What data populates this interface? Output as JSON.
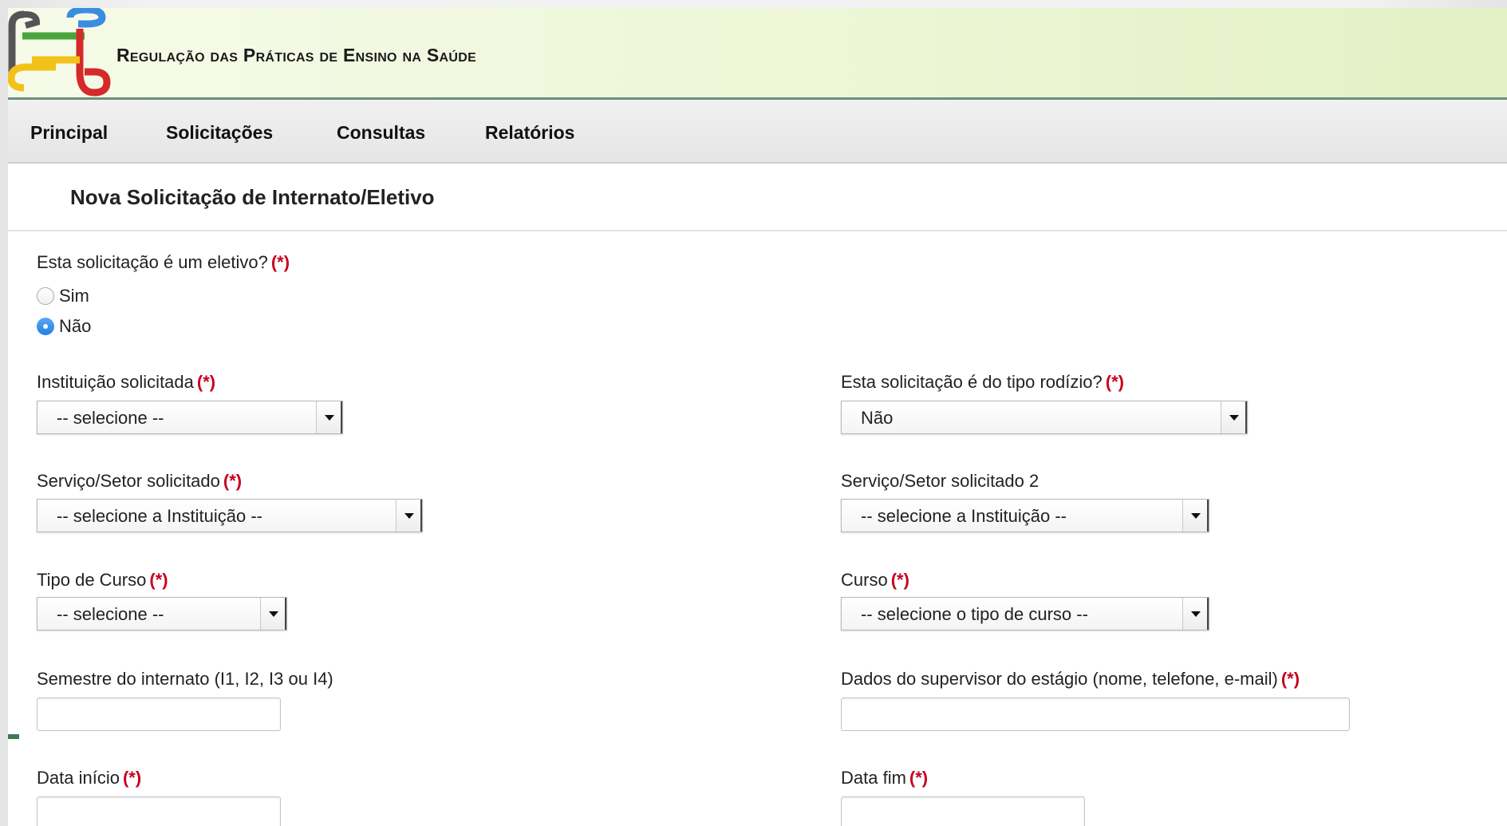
{
  "header": {
    "title": "Regulação das Práticas de Ensino na Saúde"
  },
  "nav": {
    "items": [
      "Principal",
      "Solicitações",
      "Consultas",
      "Relatórios"
    ]
  },
  "page": {
    "title": "Nova Solicitação de Internato/Eletivo",
    "required_marker": "(*)"
  },
  "form": {
    "eletivo": {
      "label": "Esta solicitação é um eletivo?",
      "options": [
        "Sim",
        "Não"
      ],
      "selected": "Não"
    },
    "instituicao": {
      "label": "Instituição solicitada",
      "value": "-- selecione --"
    },
    "rodizio": {
      "label": "Esta solicitação é do tipo rodízio?",
      "value": "Não"
    },
    "servico1": {
      "label": "Serviço/Setor solicitado",
      "value": "-- selecione a Instituição --"
    },
    "servico2": {
      "label": "Serviço/Setor solicitado 2",
      "value": "-- selecione a Instituição --"
    },
    "tipo_curso": {
      "label": "Tipo de Curso",
      "value": "-- selecione --"
    },
    "curso": {
      "label": "Curso",
      "value": "-- selecione o tipo de curso --"
    },
    "semestre": {
      "label": "Semestre do internato (I1, I2, I3 ou I4)",
      "value": ""
    },
    "supervisor": {
      "label": "Dados do supervisor do estágio (nome, telefone, e-mail)",
      "value": ""
    },
    "data_inicio": {
      "label": "Data início",
      "value": ""
    },
    "data_fim": {
      "label": "Data fim",
      "value": ""
    }
  },
  "colors": {
    "required": "#c8001e",
    "header_border": "#6d8f7e",
    "radio_selected": "#1f7fe6"
  }
}
